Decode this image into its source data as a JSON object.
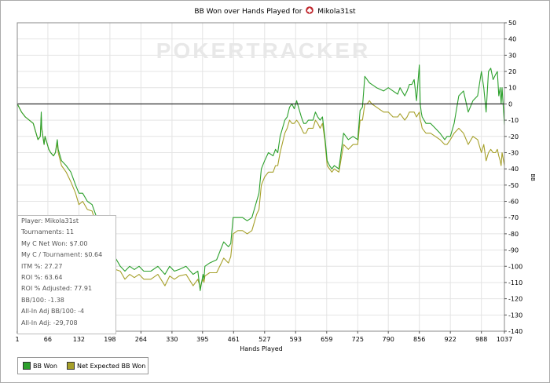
{
  "title": {
    "prefix": "BB Won over Hands Played for",
    "player": "Mikola31st"
  },
  "watermark": "POKERTRACKER",
  "stats": [
    "Player: Mikola31st",
    "Tournaments: 11",
    "My C Net Won: $7.00",
    "My C / Tournament: $0.64",
    "ITM %: 27.27",
    "ROI %: 63.64",
    "ROI % Adjusted: 77.91",
    "BB/100: -1.38",
    "All-In Adj BB/100: -4",
    "All-In Adj: -29,708"
  ],
  "legend": {
    "bb_won": "BB Won",
    "net_expected": "Net Expected BB Won"
  },
  "colors": {
    "bb_won": "#2ca02c",
    "net_expected": "#a6a02a",
    "zero_line": "#000000",
    "grid": "#e4e4e4"
  },
  "chart_data": {
    "type": "line",
    "xlabel": "Hands Played",
    "ylabel": "BB",
    "xlim": [
      1,
      1037
    ],
    "ylim": [
      -140,
      50
    ],
    "xticks": [
      1,
      66,
      132,
      198,
      264,
      330,
      395,
      461,
      527,
      593,
      659,
      725,
      790,
      856,
      922,
      988,
      1037
    ],
    "yticks": [
      50,
      40,
      30,
      20,
      10,
      0,
      -10,
      -20,
      -30,
      -40,
      -50,
      -60,
      -70,
      -80,
      -90,
      -100,
      -110,
      -120,
      -130,
      -140
    ],
    "series": [
      {
        "name": "BB Won",
        "x": [
          1,
          10,
          18,
          35,
          45,
          50,
          52,
          53,
          58,
          60,
          62,
          68,
          72,
          78,
          82,
          86,
          88,
          95,
          105,
          115,
          125,
          132,
          140,
          150,
          160,
          170,
          180,
          190,
          200,
          210,
          220,
          230,
          240,
          250,
          260,
          270,
          285,
          300,
          315,
          325,
          335,
          345,
          360,
          375,
          385,
          390,
          393,
          396,
          398,
          400,
          410,
          425,
          440,
          450,
          455,
          460,
          470,
          480,
          490,
          500,
          510,
          515,
          520,
          527,
          535,
          545,
          550,
          555,
          560,
          570,
          575,
          580,
          585,
          590,
          595,
          600,
          605,
          610,
          615,
          620,
          630,
          635,
          640,
          645,
          650,
          655,
          660,
          665,
          670,
          675,
          685,
          695,
          705,
          715,
          725,
          730,
          735,
          740,
          745,
          750,
          755,
          765,
          780,
          790,
          800,
          810,
          815,
          825,
          830,
          835,
          840,
          845,
          850,
          856,
          858,
          860,
          862,
          870,
          880,
          890,
          900,
          910,
          915,
          922,
          930,
          940,
          950,
          960,
          970,
          980,
          988,
          993,
          998,
          1003,
          1008,
          1013,
          1018,
          1022,
          1025,
          1028,
          1030,
          1032,
          1037
        ],
        "y": [
          0,
          -5,
          -8,
          -12,
          -22,
          -20,
          -5,
          -15,
          -25,
          -20,
          -22,
          -28,
          -30,
          -32,
          -30,
          -22,
          -28,
          -35,
          -38,
          -42,
          -50,
          -55,
          -55,
          -60,
          -62,
          -70,
          -78,
          -85,
          -90,
          -95,
          -100,
          -103,
          -100,
          -102,
          -100,
          -103,
          -103,
          -100,
          -105,
          -100,
          -103,
          -102,
          -100,
          -105,
          -103,
          -115,
          -110,
          -105,
          -108,
          -100,
          -98,
          -96,
          -85,
          -88,
          -86,
          -70,
          -70,
          -70,
          -72,
          -70,
          -60,
          -55,
          -40,
          -35,
          -30,
          -32,
          -28,
          -30,
          -20,
          -10,
          -8,
          -2,
          0,
          -3,
          2,
          -3,
          -8,
          -12,
          -12,
          -10,
          -10,
          -5,
          -8,
          -10,
          -8,
          -20,
          -35,
          -38,
          -40,
          -38,
          -40,
          -18,
          -22,
          -20,
          -22,
          -4,
          -2,
          17,
          15,
          13,
          12,
          10,
          8,
          10,
          8,
          6,
          10,
          5,
          8,
          12,
          12,
          15,
          2,
          24,
          0,
          -5,
          -8,
          -12,
          -12,
          -15,
          -18,
          -22,
          -20,
          -20,
          -12,
          5,
          8,
          -5,
          2,
          5,
          20,
          10,
          -5,
          20,
          22,
          15,
          18,
          20,
          5,
          10,
          0,
          10,
          -13
        ]
      },
      {
        "name": "Net Expected BB Won",
        "x": [
          1,
          10,
          18,
          35,
          45,
          50,
          52,
          53,
          58,
          60,
          62,
          68,
          72,
          78,
          82,
          86,
          88,
          95,
          105,
          115,
          125,
          132,
          140,
          150,
          160,
          170,
          180,
          190,
          200,
          210,
          220,
          230,
          240,
          250,
          260,
          270,
          285,
          300,
          315,
          325,
          335,
          345,
          360,
          375,
          385,
          390,
          393,
          396,
          398,
          400,
          410,
          425,
          440,
          450,
          455,
          460,
          470,
          480,
          490,
          500,
          510,
          515,
          520,
          527,
          535,
          545,
          550,
          555,
          560,
          570,
          575,
          580,
          585,
          590,
          595,
          600,
          605,
          610,
          615,
          620,
          630,
          635,
          640,
          645,
          650,
          655,
          660,
          665,
          670,
          675,
          685,
          695,
          705,
          715,
          725,
          730,
          735,
          740,
          745,
          750,
          755,
          765,
          780,
          790,
          800,
          810,
          815,
          825,
          830,
          835,
          840,
          845,
          850,
          856,
          858,
          860,
          862,
          870,
          880,
          890,
          900,
          910,
          915,
          922,
          930,
          940,
          950,
          960,
          970,
          980,
          988,
          993,
          998,
          1003,
          1008,
          1013,
          1018,
          1022,
          1025,
          1028,
          1030,
          1032,
          1037
        ],
        "y": [
          0,
          -5,
          -8,
          -12,
          -22,
          -20,
          -8,
          -15,
          -25,
          -20,
          -22,
          -28,
          -30,
          -32,
          -30,
          -24,
          -30,
          -38,
          -42,
          -48,
          -55,
          -62,
          -60,
          -65,
          -66,
          -75,
          -85,
          -98,
          -100,
          -102,
          -103,
          -108,
          -105,
          -107,
          -105,
          -108,
          -108,
          -105,
          -112,
          -106,
          -108,
          -106,
          -105,
          -112,
          -108,
          -113,
          -110,
          -108,
          -110,
          -106,
          -104,
          -104,
          -95,
          -98,
          -94,
          -80,
          -78,
          -78,
          -80,
          -78,
          -68,
          -65,
          -50,
          -45,
          -42,
          -42,
          -38,
          -38,
          -30,
          -18,
          -15,
          -10,
          -12,
          -12,
          -10,
          -12,
          -15,
          -18,
          -18,
          -15,
          -15,
          -10,
          -12,
          -15,
          -12,
          -22,
          -38,
          -40,
          -42,
          -40,
          -42,
          -25,
          -28,
          -25,
          -25,
          -10,
          -10,
          0,
          0,
          2,
          0,
          -2,
          -5,
          -5,
          -8,
          -8,
          -6,
          -10,
          -8,
          -5,
          -5,
          -5,
          -8,
          -5,
          -10,
          -12,
          -15,
          -18,
          -18,
          -20,
          -22,
          -25,
          -25,
          -22,
          -18,
          -15,
          -18,
          -25,
          -20,
          -22,
          -30,
          -25,
          -35,
          -30,
          -28,
          -30,
          -30,
          -28,
          -32,
          -35,
          -38,
          -30,
          -38
        ]
      }
    ]
  }
}
